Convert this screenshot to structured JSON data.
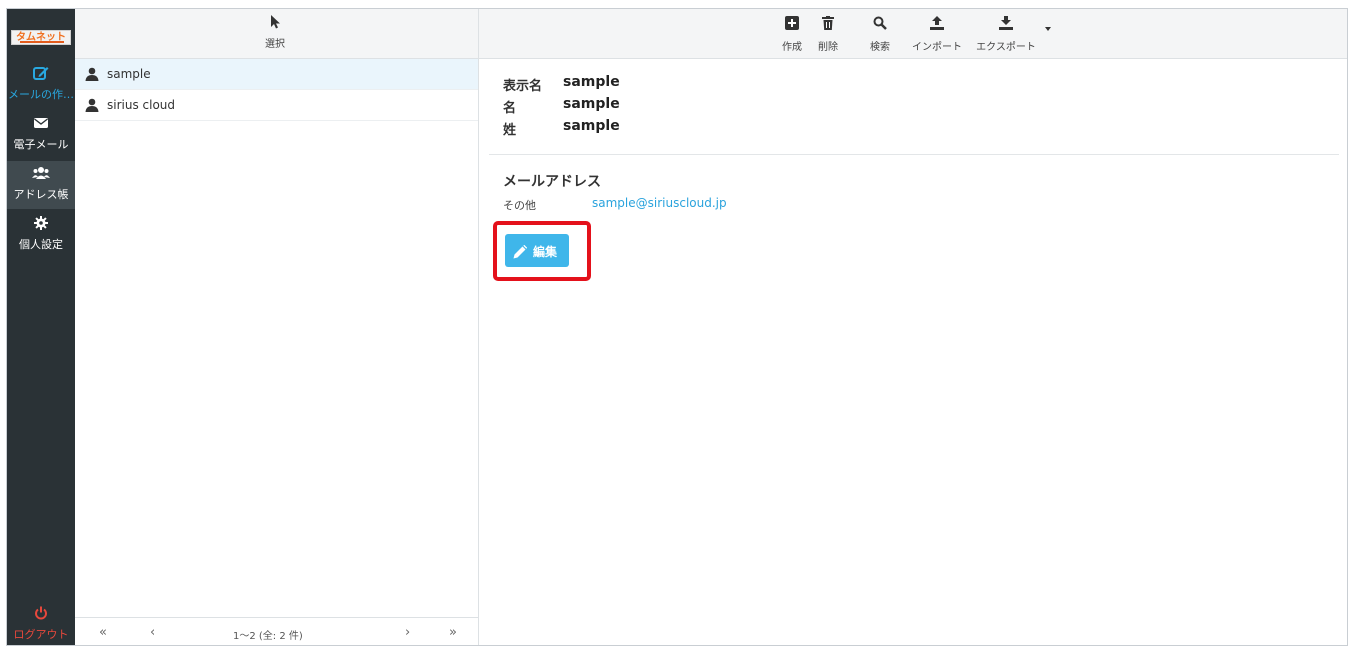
{
  "app": {
    "logo_text": "タムネット"
  },
  "nav": {
    "items": [
      {
        "label": "メールの作…",
        "icon": "compose-icon",
        "color": "#29a8e0"
      },
      {
        "label": "電子メール",
        "icon": "envelope-icon"
      },
      {
        "label": "アドレス帳",
        "icon": "contacts-icon",
        "active": true
      },
      {
        "label": "個人設定",
        "icon": "gear-icon"
      }
    ],
    "logout": {
      "label": "ログアウト",
      "icon": "power-icon",
      "color": "#e8483c"
    }
  },
  "list": {
    "toolbar": {
      "select_label": "選択",
      "select_icon": "cursor-icon"
    },
    "contacts": [
      {
        "name": "sample",
        "selected": true
      },
      {
        "name": "sirius cloud",
        "selected": false
      }
    ],
    "pager": {
      "first": "«",
      "prev": "‹",
      "next": "›",
      "last": "»",
      "count_text": "1～2 (全: 2 件)"
    }
  },
  "toolbar": {
    "buttons": [
      {
        "label": "作成",
        "icon": "plus-square-icon"
      },
      {
        "label": "削除",
        "icon": "trash-icon"
      },
      {
        "label": "検索",
        "icon": "search-icon"
      },
      {
        "label": "インポート",
        "icon": "upload-icon"
      },
      {
        "label": "エクスポート",
        "icon": "download-icon"
      }
    ]
  },
  "contact": {
    "display_name_label": "表示名",
    "display_name": "sample",
    "first_name_label": "名",
    "first_name": "sample",
    "last_name_label": "姓",
    "last_name": "sample",
    "email_section_title": "メールアドレス",
    "email_type": "その他",
    "email": "sample@siriuscloud.jp",
    "edit_label": "編集"
  },
  "colors": {
    "accent": "#3fb6ea",
    "highlight": "#e4111b",
    "sidebar": "#2a3236"
  }
}
